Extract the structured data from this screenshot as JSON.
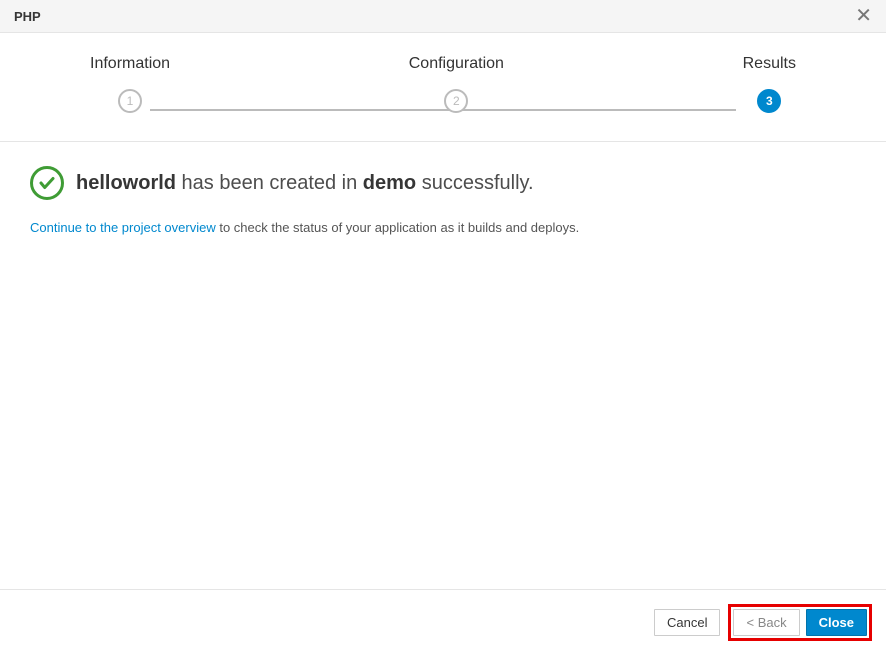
{
  "header": {
    "title": "PHP"
  },
  "steps": [
    {
      "label": "Information",
      "num": "1"
    },
    {
      "label": "Configuration",
      "num": "2"
    },
    {
      "label": "Results",
      "num": "3"
    }
  ],
  "result": {
    "app_name": "helloworld",
    "mid1": " has been created in ",
    "project_name": "demo",
    "mid2": " successfully."
  },
  "followup": {
    "link": "Continue to the project overview",
    "text": " to check the status of your application as it builds and deploys."
  },
  "footer": {
    "cancel": "Cancel",
    "back": "< Back",
    "close": "Close"
  }
}
